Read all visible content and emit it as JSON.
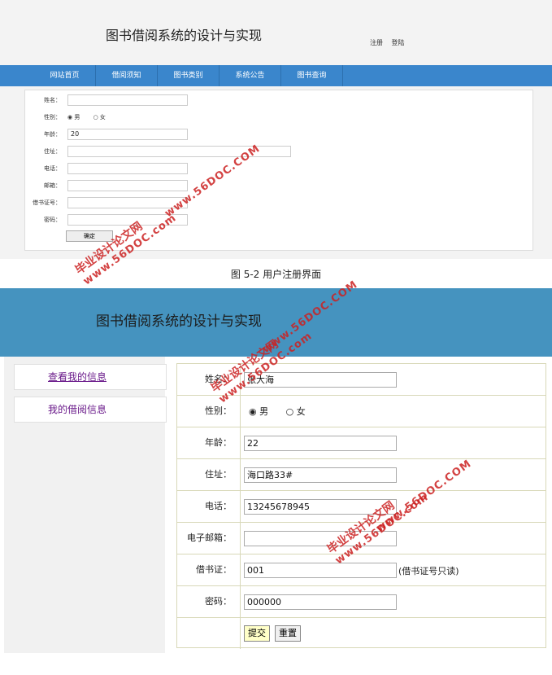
{
  "top": {
    "title": "图书借阅系统的设计与实现",
    "links": [
      "注册",
      "登陆"
    ],
    "nav": [
      "网站首页",
      "借阅须知",
      "图书类别",
      "系统公告",
      "图书查询"
    ],
    "form": {
      "name_label": "姓名：",
      "gender_label": "性别：",
      "gender_male": "◉ 男",
      "gender_female": "○ 女",
      "age_label": "年龄：",
      "age_value": "20",
      "address_label": "住址：",
      "phone_label": "电话：",
      "email_label": "邮箱：",
      "card_label": "借书证号：",
      "password_label": "密码：",
      "submit": "确定"
    }
  },
  "caption": "图 5-2 用户注册界面",
  "bottom": {
    "title": "图书借阅系统的设计与实现",
    "sidebar": [
      "查看我的信息",
      "我的借阅信息"
    ],
    "form": {
      "name_label": "姓名：",
      "name_value": "张大海",
      "gender_label": "性别：",
      "gender_male": "◉ 男",
      "gender_female": "○ 女",
      "age_label": "年龄：",
      "age_value": "22",
      "address_label": "住址：",
      "address_value": "海口路33#",
      "phone_label": "电话：",
      "phone_value": "13245678945",
      "email_label": "电子邮箱：",
      "email_value": "",
      "card_label": "借书证：",
      "card_value": "001",
      "card_note": "(借书证号只读)",
      "password_label": "密码：",
      "password_value": "000000",
      "submit": "提交",
      "reset": "重置"
    }
  },
  "watermark": {
    "cn": "毕业设计论文网",
    "url": "www.56DOC.com",
    "domain": "www.56DOC.COM"
  }
}
